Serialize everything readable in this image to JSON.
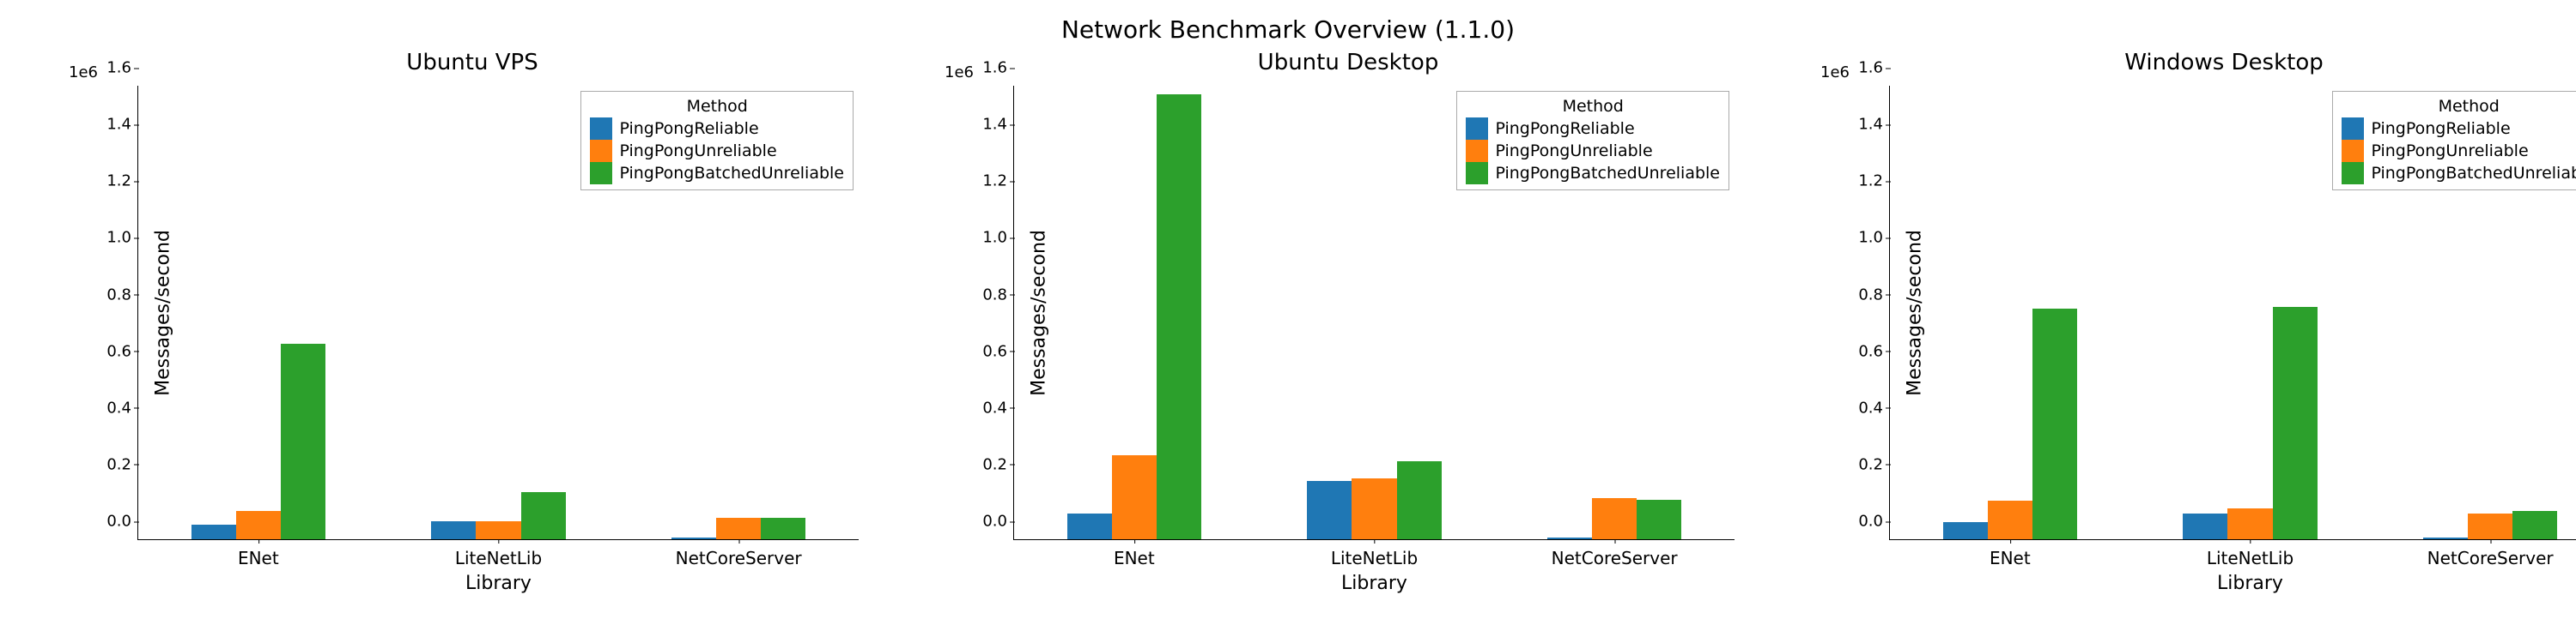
{
  "suptitle": "Network Benchmark Overview (1.1.0)",
  "legend_title": "Method",
  "colors": {
    "s0": "#1f77b4",
    "s1": "#ff7f0e",
    "s2": "#2ca02c"
  },
  "xlabel": "Library",
  "ylabel": "Messages/second",
  "y_exp_label": "1e6",
  "chart_data": [
    {
      "type": "bar",
      "title": "Ubuntu VPS",
      "categories": [
        "ENet",
        "LiteNetLib",
        "NetCoreServer"
      ],
      "series": [
        {
          "name": "PingPongReliable",
          "values": [
            50000,
            65000,
            5000
          ]
        },
        {
          "name": "PingPongUnreliable",
          "values": [
            100000,
            65000,
            75000
          ]
        },
        {
          "name": "PingPongBatchedUnreliable",
          "values": [
            690000,
            165000,
            75000
          ]
        }
      ],
      "ylim": [
        0,
        1600000
      ],
      "yticks": [
        0,
        200000,
        400000,
        600000,
        800000,
        1000000,
        1200000,
        1400000,
        1600000
      ],
      "ytick_labels": [
        "0.0",
        "0.2",
        "0.4",
        "0.6",
        "0.8",
        "1.0",
        "1.2",
        "1.4",
        "1.6"
      ]
    },
    {
      "type": "bar",
      "title": "Ubuntu Desktop",
      "categories": [
        "ENet",
        "LiteNetLib",
        "NetCoreServer"
      ],
      "series": [
        {
          "name": "PingPongReliable",
          "values": [
            90000,
            205000,
            5000
          ]
        },
        {
          "name": "PingPongUnreliable",
          "values": [
            295000,
            215000,
            145000
          ]
        },
        {
          "name": "PingPongBatchedUnreliable",
          "values": [
            1570000,
            275000,
            140000
          ]
        }
      ],
      "ylim": [
        0,
        1600000
      ],
      "yticks": [
        0,
        200000,
        400000,
        600000,
        800000,
        1000000,
        1200000,
        1400000,
        1600000
      ],
      "ytick_labels": [
        "0.0",
        "0.2",
        "0.4",
        "0.6",
        "0.8",
        "1.0",
        "1.2",
        "1.4",
        "1.6"
      ]
    },
    {
      "type": "bar",
      "title": "Windows Desktop",
      "categories": [
        "ENet",
        "LiteNetLib",
        "NetCoreServer"
      ],
      "series": [
        {
          "name": "PingPongReliable",
          "values": [
            60000,
            90000,
            5000
          ]
        },
        {
          "name": "PingPongUnreliable",
          "values": [
            135000,
            110000,
            90000
          ]
        },
        {
          "name": "PingPongBatchedUnreliable",
          "values": [
            815000,
            820000,
            100000
          ]
        }
      ],
      "ylim": [
        0,
        1600000
      ],
      "yticks": [
        0,
        200000,
        400000,
        600000,
        800000,
        1000000,
        1200000,
        1400000,
        1600000
      ],
      "ytick_labels": [
        "0.0",
        "0.2",
        "0.4",
        "0.6",
        "0.8",
        "1.0",
        "1.2",
        "1.4",
        "1.6"
      ]
    }
  ]
}
